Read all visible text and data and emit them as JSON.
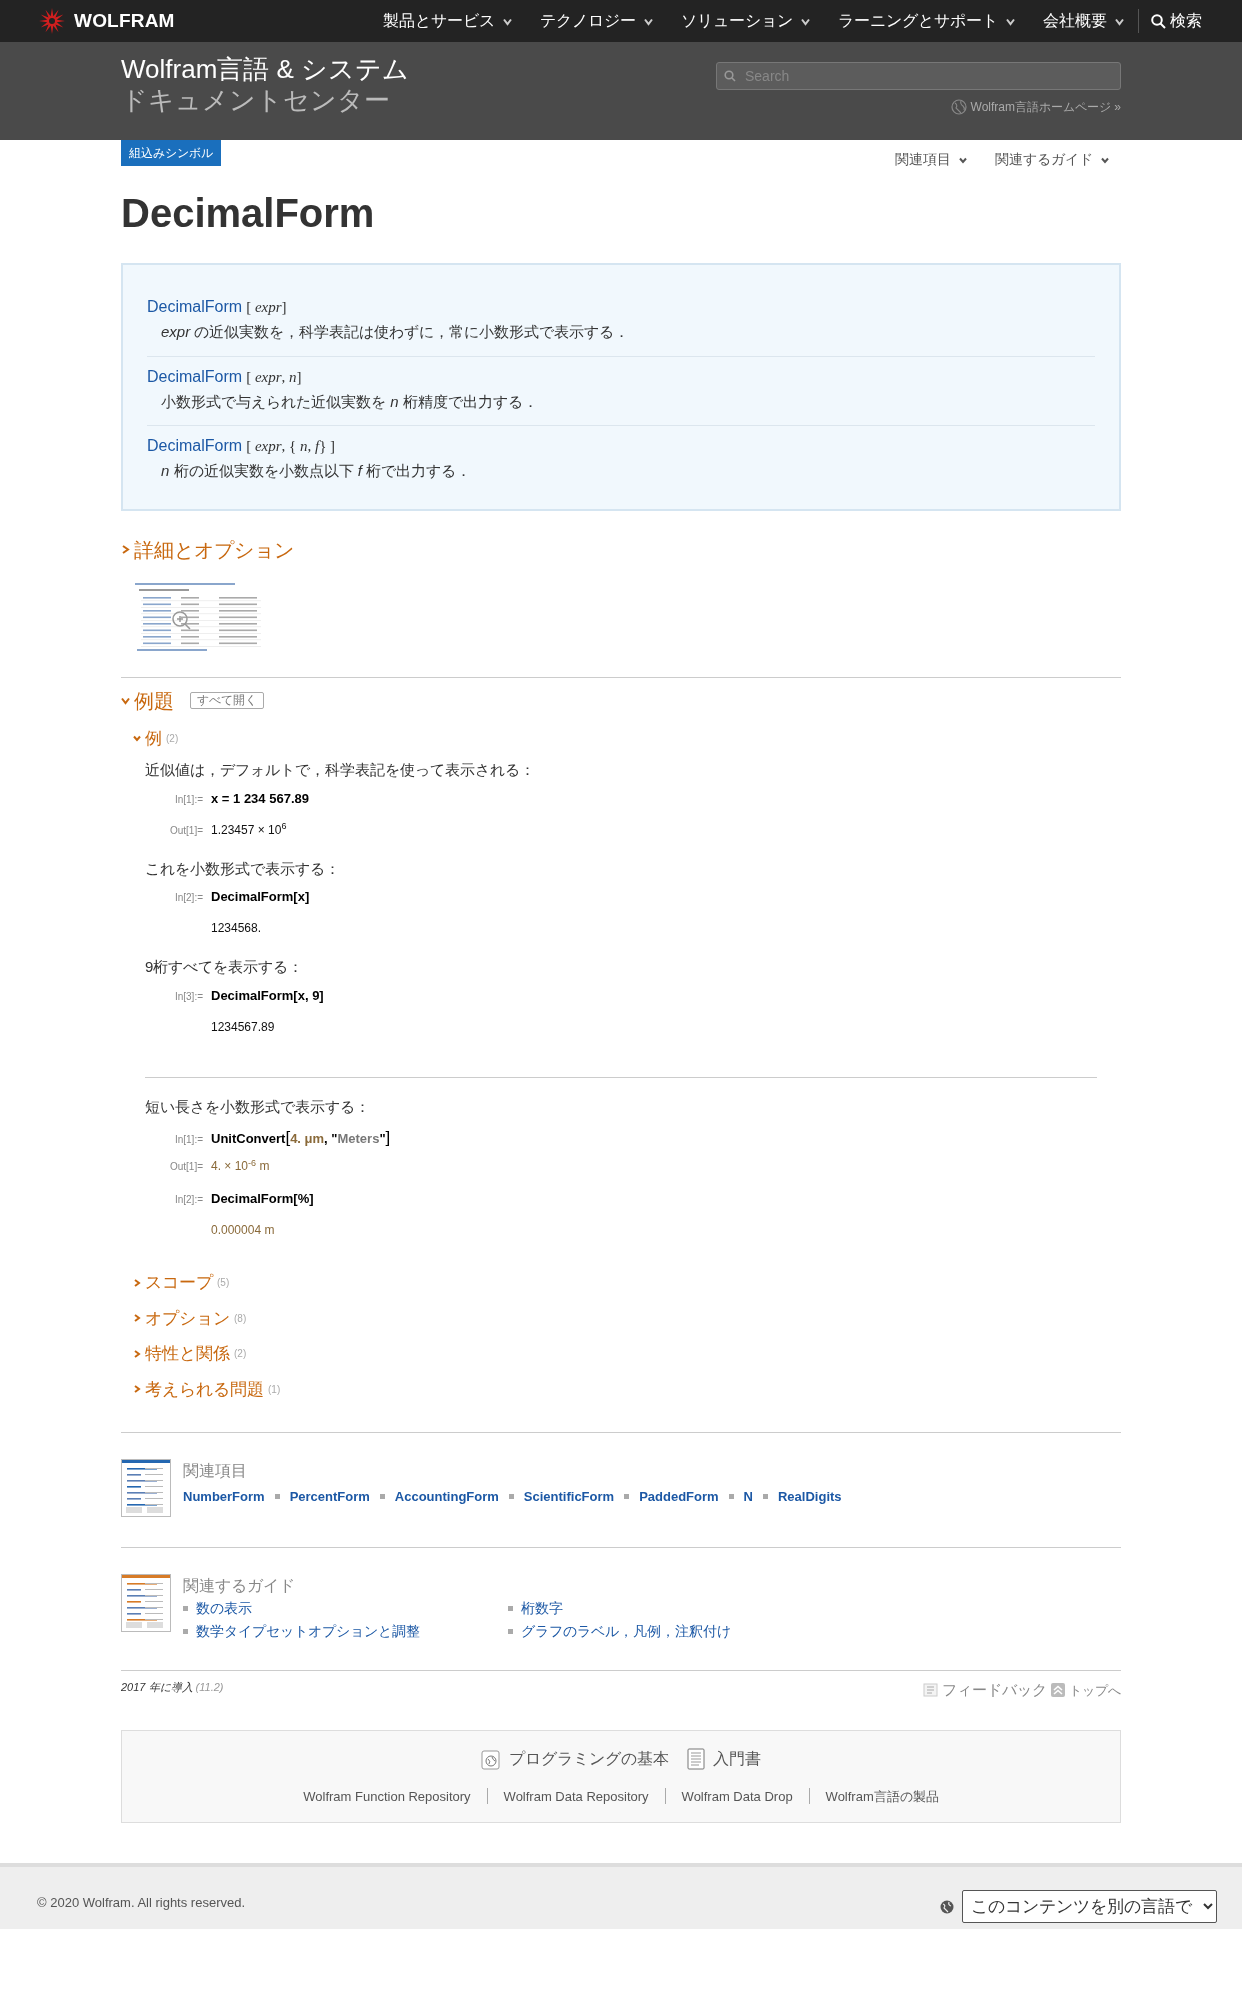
{
  "topnav": {
    "logo": "WOLFRAM",
    "menus": [
      "製品とサービス",
      "テクノロジー",
      "ソリューション",
      "ラーニングとサポート",
      "会社概要"
    ],
    "search": "検索"
  },
  "header": {
    "title_line1": "Wolfram言語 & システム",
    "title_line2": "ドキュメントセンター",
    "search_placeholder": "Search",
    "home_link": "Wolfram言語ホームページ »"
  },
  "badge": "組込みシンボル",
  "related_menus": [
    "関連項目",
    "関連するガイド"
  ],
  "title": "DecimalForm",
  "usage": [
    {
      "name": "DecimalForm",
      "args": "[ *expr*]",
      "description": "*expr* の近似実数を，科学表記は使わずに，常に小数形式で表示する．"
    },
    {
      "name": "DecimalForm",
      "args": "[ *expr*, *n*]",
      "description": "小数形式で与えられた近似実数を *n* 桁精度で出力する．"
    },
    {
      "name": "DecimalForm",
      "args": "[ *expr*, { *n*, *f*} ]",
      "description": "*n* 桁の近似実数を小数点以下 *f* 桁で出力する．"
    }
  ],
  "details": {
    "heading": "詳細とオプション",
    "expanded": false
  },
  "examples": {
    "heading": "例題",
    "expanded": true,
    "expand_all": "すべて開く",
    "sections": [
      {
        "title": "例",
        "count": "(2)",
        "expanded": true,
        "groups": [
          [
            {
              "kind": "text",
              "text": "近似値は，デフォルトで，科学表記を使って表示される："
            },
            {
              "kind": "in",
              "label": "In[1]:=",
              "code": [
                {
                  "kind": "plain",
                  "text": "x = 1 234 567.89"
                }
              ]
            },
            {
              "kind": "out",
              "label": "Out[1]=",
              "value": "1.23457 × 10$^{6}$"
            },
            {
              "kind": "text",
              "text": "これを小数形式で表示する："
            },
            {
              "kind": "in",
              "label": "In[2]:=",
              "code": [
                {
                  "kind": "plain",
                  "text": "DecimalForm[x]"
                }
              ]
            },
            {
              "kind": "out",
              "value": "1234568."
            },
            {
              "kind": "text",
              "text": "9桁すべてを表示する："
            },
            {
              "kind": "in",
              "label": "In[3]:=",
              "code": [
                {
                  "kind": "plain",
                  "text": "DecimalForm[x, 9]"
                }
              ]
            },
            {
              "kind": "out",
              "value": "1234567.89"
            }
          ],
          [
            {
              "kind": "text",
              "text": "短い長さを小数形式で表示する："
            },
            {
              "kind": "in",
              "label": "In[1]:=",
              "code": [
                {
                  "kind": "plain",
                  "text": "UnitConvert"
                },
                {
                  "kind": "bracket",
                  "text": "["
                },
                {
                  "kind": "quantity",
                  "text": "4. μm"
                },
                {
                  "kind": "plain",
                  "text": ", \""
                },
                {
                  "kind": "string",
                  "text": "Meters"
                },
                {
                  "kind": "plain",
                  "text": "\""
                },
                {
                  "kind": "bracket",
                  "text": "]"
                }
              ]
            },
            {
              "kind": "quantity",
              "label": "Out[1]=",
              "value": "4. × 10$^{-6}$ m"
            },
            {
              "kind": "in",
              "label": "In[2]:=",
              "code": [
                {
                  "kind": "plain",
                  "text": "DecimalForm[%]"
                }
              ]
            },
            {
              "kind": "quantity",
              "value": "0.000004 m"
            }
          ]
        ]
      },
      {
        "title": "スコープ",
        "count": "(5)",
        "expanded": false
      },
      {
        "title": "オプション",
        "count": "(8)",
        "expanded": false
      },
      {
        "title": "特性と関係",
        "count": "(2)",
        "expanded": false
      },
      {
        "title": "考えられる問題",
        "count": "(1)",
        "expanded": false
      }
    ]
  },
  "see_also": {
    "heading": "関連項目",
    "links": [
      "NumberForm",
      "PercentForm",
      "AccountingForm",
      "ScientificForm",
      "PaddedForm",
      "N",
      "RealDigits"
    ]
  },
  "guides": {
    "heading": "関連するガイド",
    "links": [
      "数の表示",
      "桁数字",
      "数学タイプセットオプションと調整",
      "グラフのラベル，凡例，注釈付け"
    ]
  },
  "meta": {
    "introduced": "2017 年に導入",
    "version": "(11.2)",
    "feedback": "フィードバック",
    "top": "トップへ"
  },
  "resources": {
    "main": [
      "プログラミングの基本",
      "入門書"
    ],
    "links": [
      "Wolfram Function Repository",
      "Wolfram Data Repository",
      "Wolfram Data Drop",
      "Wolfram言語の製品"
    ]
  },
  "footer": {
    "copyright": "© 2020 Wolfram. All rights reserved.",
    "language": "このコンテンツを別の言語で"
  }
}
